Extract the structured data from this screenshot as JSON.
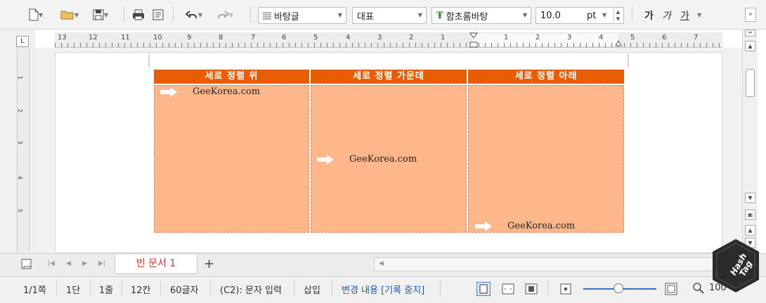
{
  "toolbar": {
    "icons": [
      "new-document-icon",
      "open-folder-icon",
      "save-icon",
      "print-icon",
      "preview-icon",
      "undo-icon",
      "redo-icon"
    ],
    "style_select": "바탕글",
    "language_select": "대표",
    "font_select": "함초롬바탕",
    "font_size": "10.0",
    "font_unit": "pt",
    "bold_glyph": "가",
    "italic_glyph": "가",
    "underline_glyph": "가"
  },
  "ruler": {
    "labels": [
      "13",
      "12",
      "11",
      "10",
      "9",
      "8",
      "7",
      "6",
      "5",
      "4",
      "3",
      "2",
      "1",
      "1",
      "2",
      "3",
      "4",
      "5",
      "6",
      "7"
    ],
    "vertical_labels": [
      "1",
      "2",
      "3",
      "4",
      "5"
    ]
  },
  "table": {
    "headers": [
      "세로 정렬 위",
      "세로 정렬 가운데",
      "세로 정렬 아래"
    ],
    "cells": [
      "GeeKorea.com",
      "GeeKorea.com",
      "GeeKorea.com"
    ],
    "colors": {
      "header_bg": "#e85d04",
      "cell_bg": "#fdb78a",
      "arrow": "#ffffff"
    }
  },
  "tabs": {
    "active_tab": "빈 문서 1",
    "add_label": "+"
  },
  "status": {
    "page": "1/1쪽",
    "column": "1단",
    "line": "1줄",
    "position": "12칸",
    "chars": "60글자",
    "mode": "(C2): 문자 입력",
    "insert": "삽입",
    "track_changes": "변경 내용 [기록 중지]",
    "zoom": "100"
  },
  "watermark": {
    "line1": "Hash",
    "line2": "Tag"
  }
}
